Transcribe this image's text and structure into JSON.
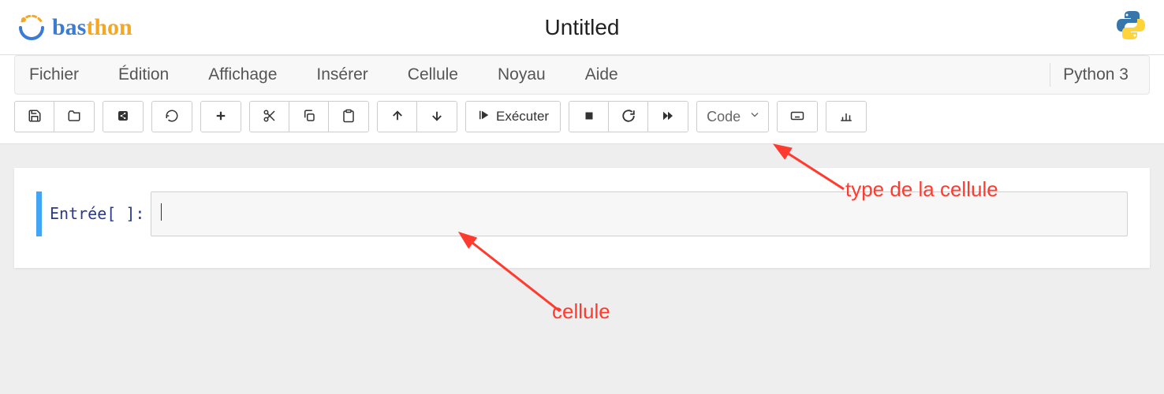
{
  "header": {
    "title": "Untitled",
    "logo_text_1": "bas",
    "logo_text_2": "thon"
  },
  "menu": {
    "items": [
      "Fichier",
      "Édition",
      "Affichage",
      "Insérer",
      "Cellule",
      "Noyau",
      "Aide"
    ],
    "kernel": "Python 3"
  },
  "toolbar": {
    "run_label": "Exécuter",
    "celltype": "Code"
  },
  "cell": {
    "prompt": "Entrée[ ]:"
  },
  "annotations": {
    "celltype": "type de la cellule",
    "cell": "cellule"
  }
}
